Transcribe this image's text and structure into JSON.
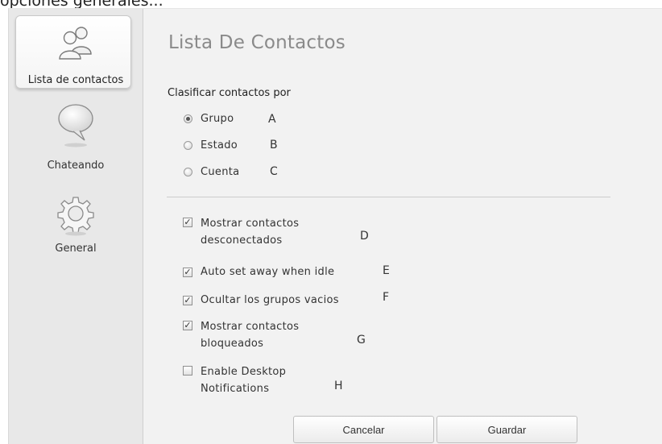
{
  "caption": "opciones generales...",
  "sidebar": {
    "items": [
      {
        "label": "Lista de contactos",
        "icon": "contacts-icon",
        "active": true
      },
      {
        "label": "Chateando",
        "icon": "chat-bubble-icon",
        "active": false
      },
      {
        "label": "General",
        "icon": "gear-icon",
        "active": false
      }
    ]
  },
  "main": {
    "title": "Lista De Contactos",
    "sort_label": "Clasificar contactos por",
    "sort_options": [
      {
        "label": "Grupo",
        "marker": "A",
        "checked": true
      },
      {
        "label": "Estado",
        "marker": "B",
        "checked": false
      },
      {
        "label": "Cuenta",
        "marker": "C",
        "checked": false
      }
    ],
    "checkboxes": [
      {
        "label": "Mostrar contactos desconectados",
        "marker": "D",
        "checked": true
      },
      {
        "label": "Auto set away when idle",
        "marker": "E",
        "checked": true
      },
      {
        "label": "Ocultar los grupos vacios",
        "marker": "F",
        "checked": true
      },
      {
        "label": "Mostrar contactos bloqueados",
        "marker": "G",
        "checked": true
      },
      {
        "label": "Enable Desktop Notifications",
        "marker": "H",
        "checked": false
      }
    ]
  },
  "footer": {
    "cancel_label": "Cancelar",
    "save_label": "Guardar"
  },
  "colors": {
    "sidebar_bg": "#e8e8e8",
    "content_bg": "#f2f2f2",
    "title": "#8a8a8a"
  }
}
